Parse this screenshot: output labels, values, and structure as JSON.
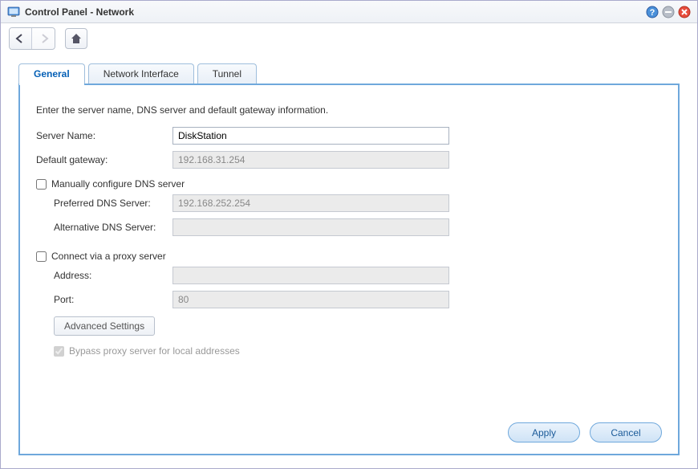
{
  "window": {
    "title": "Control Panel - Network"
  },
  "tabs": {
    "general": "General",
    "interface": "Network Interface",
    "tunnel": "Tunnel"
  },
  "panel": {
    "intro": "Enter the server name, DNS server and default gateway information.",
    "server_name_label": "Server Name:",
    "server_name_value": "DiskStation",
    "gateway_label": "Default gateway:",
    "gateway_value": "192.168.31.254",
    "manual_dns_label": "Manually configure DNS server",
    "pref_dns_label": "Preferred DNS Server:",
    "pref_dns_value": "192.168.252.254",
    "alt_dns_label": "Alternative DNS Server:",
    "alt_dns_value": "",
    "proxy_label": "Connect via a proxy server",
    "proxy_addr_label": "Address:",
    "proxy_addr_value": "",
    "proxy_port_label": "Port:",
    "proxy_port_value": "80",
    "advanced_btn": "Advanced Settings",
    "bypass_label": "Bypass proxy server for local addresses"
  },
  "footer": {
    "apply": "Apply",
    "cancel": "Cancel"
  }
}
